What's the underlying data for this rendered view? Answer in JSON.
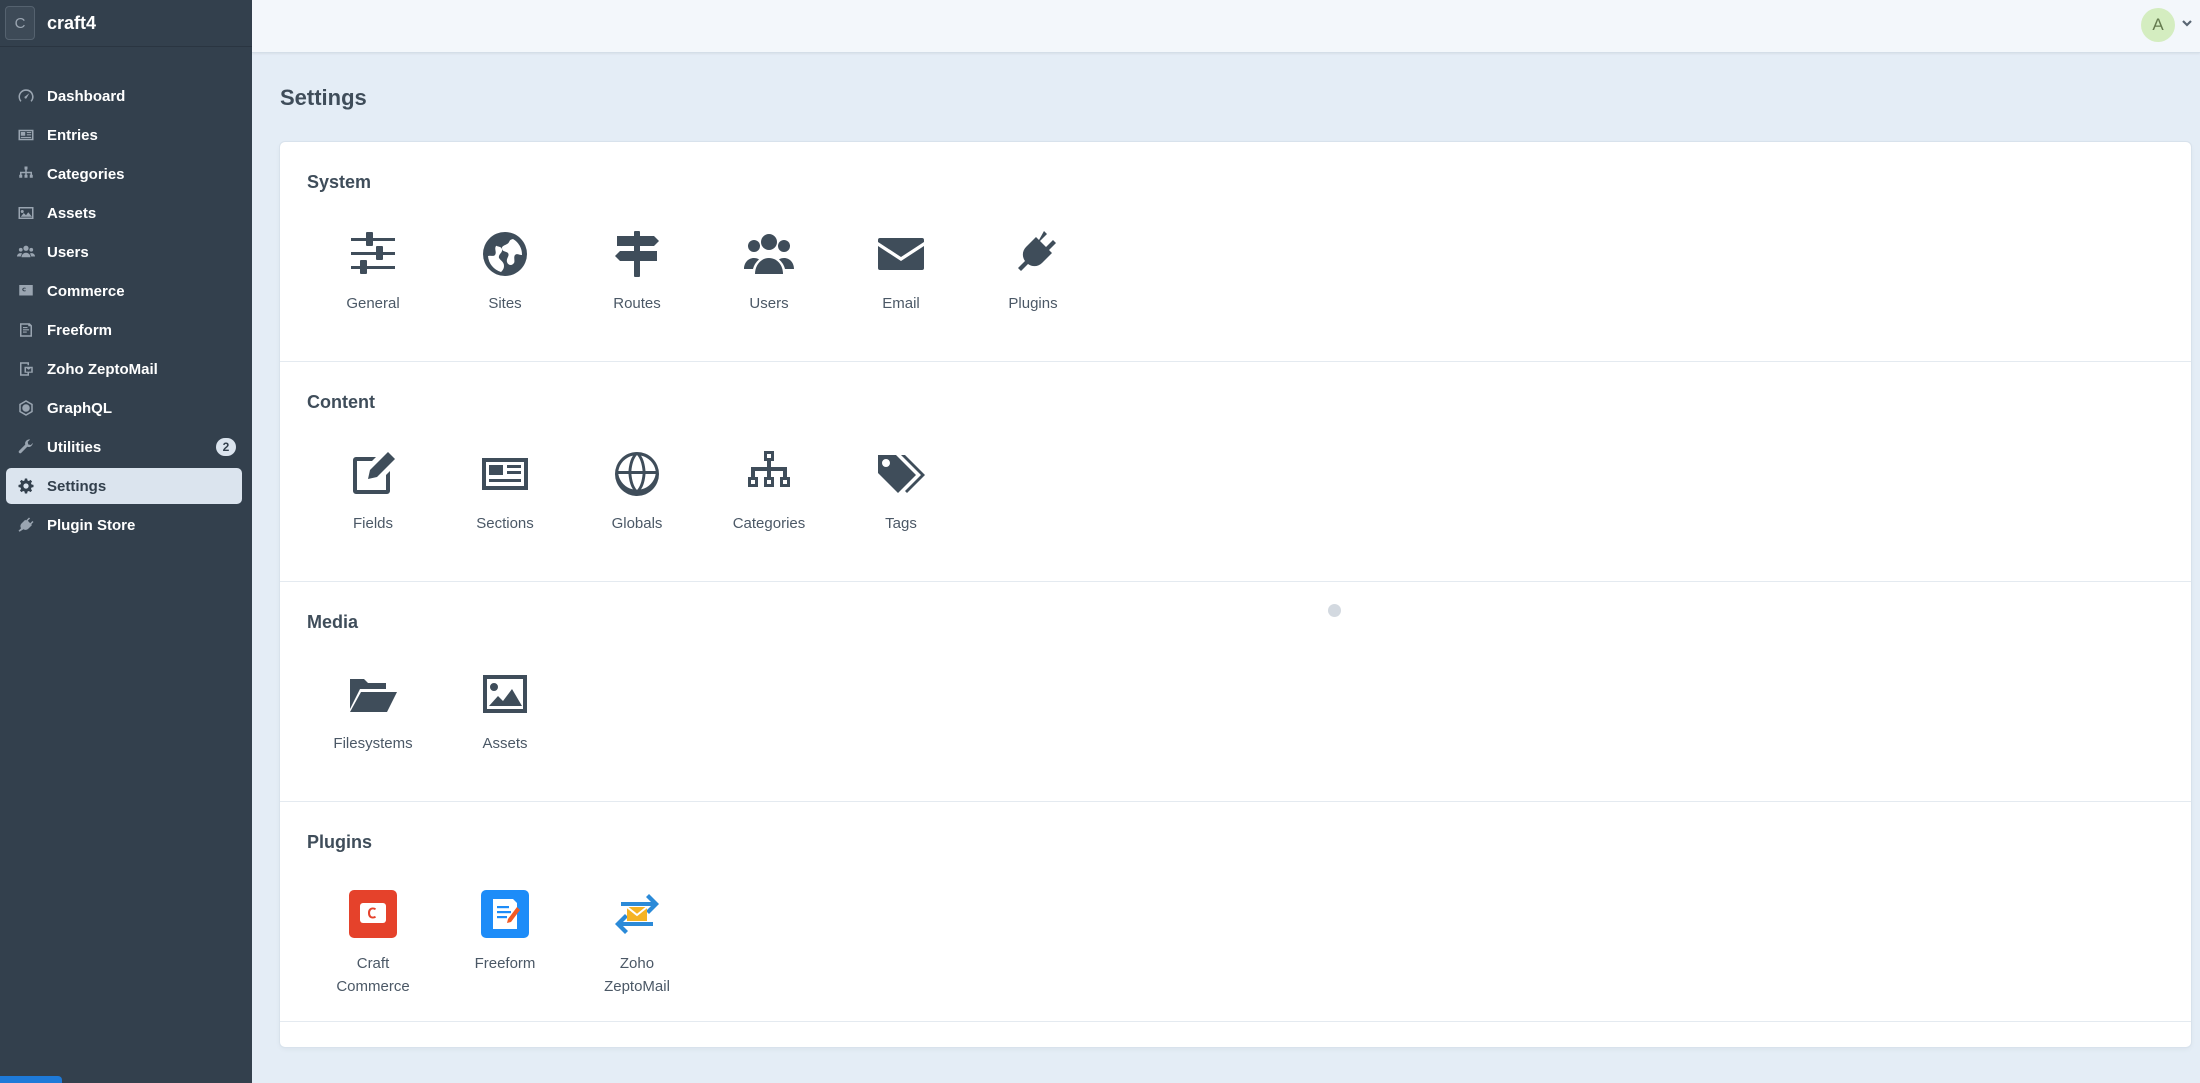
{
  "brand": {
    "logo_letter": "C",
    "name": "craft4"
  },
  "sidebar": {
    "items": [
      {
        "label": "Dashboard",
        "icon": "gauge-icon"
      },
      {
        "label": "Entries",
        "icon": "newspaper-icon"
      },
      {
        "label": "Categories",
        "icon": "sitemap-icon"
      },
      {
        "label": "Assets",
        "icon": "image-icon"
      },
      {
        "label": "Users",
        "icon": "users-icon"
      },
      {
        "label": "Commerce",
        "icon": "commerce-icon"
      },
      {
        "label": "Freeform",
        "icon": "freeform-icon"
      },
      {
        "label": "Zoho ZeptoMail",
        "icon": "zeptomail-icon"
      },
      {
        "label": "GraphQL",
        "icon": "graphql-icon"
      },
      {
        "label": "Utilities",
        "icon": "wrench-icon",
        "badge": "2"
      },
      {
        "label": "Settings",
        "icon": "gear-icon",
        "active": true
      },
      {
        "label": "Plugin Store",
        "icon": "plug-icon"
      }
    ]
  },
  "header": {
    "avatar_letter": "A",
    "avatar_color": "#d4edc0"
  },
  "page": {
    "title": "Settings"
  },
  "sections": {
    "system": {
      "title": "System",
      "items": [
        "General",
        "Sites",
        "Routes",
        "Users",
        "Email",
        "Plugins"
      ]
    },
    "content": {
      "title": "Content",
      "items": [
        "Fields",
        "Sections",
        "Globals",
        "Categories",
        "Tags"
      ]
    },
    "media": {
      "title": "Media",
      "items": [
        "Filesystems",
        "Assets"
      ]
    },
    "plugins": {
      "title": "Plugins",
      "items": [
        "Craft Commerce",
        "Freeform",
        "Zoho ZeptoMail"
      ]
    }
  },
  "colors": {
    "sidebar_bg": "#33404d",
    "commerce_brand": "#e5422b",
    "freeform_brand": "#1d8cf8",
    "zepto_blue": "#2b8ad8",
    "zepto_yellow": "#f5b324"
  }
}
